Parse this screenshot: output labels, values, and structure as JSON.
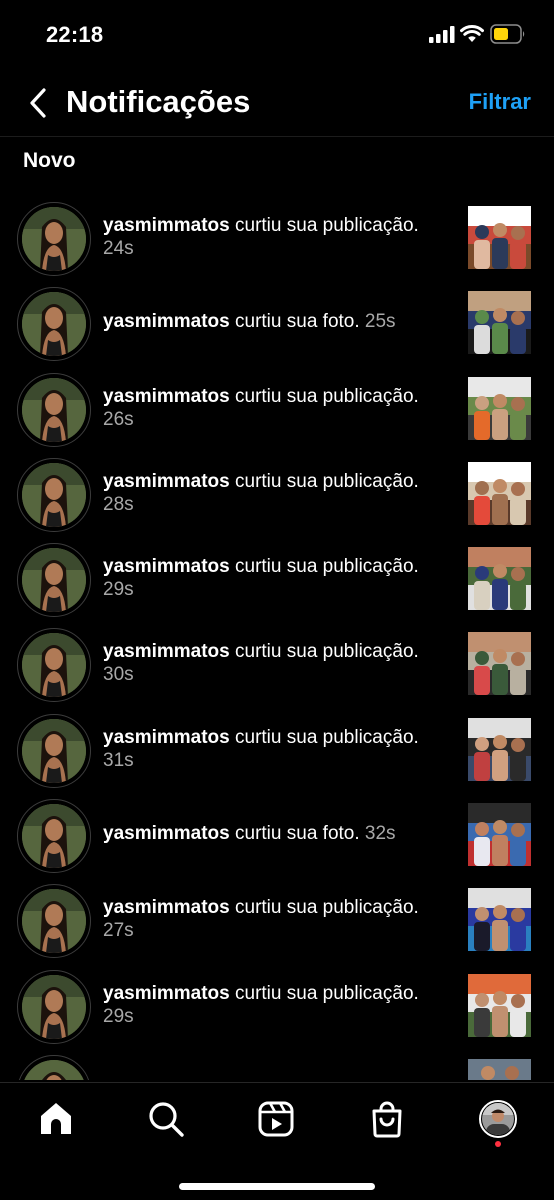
{
  "status_bar": {
    "time": "22:18",
    "battery_color": "#ffd60a"
  },
  "header": {
    "title": "Notificações",
    "filter_label": "Filtrar",
    "accent_color": "#1ea1f7"
  },
  "section": {
    "label": "Novo"
  },
  "notifications": [
    {
      "username": "yasmimmatos",
      "action": " curtiu sua publicação.",
      "time": "24s"
    },
    {
      "username": "yasmimmatos",
      "action": " curtiu sua foto.",
      "time": "25s"
    },
    {
      "username": "yasmimmatos",
      "action": " curtiu sua publicação.",
      "time": "26s"
    },
    {
      "username": "yasmimmatos",
      "action": " curtiu sua publicação.",
      "time": "28s"
    },
    {
      "username": "yasmimmatos",
      "action": " curtiu sua publicação.",
      "time": "29s"
    },
    {
      "username": "yasmimmatos",
      "action": " curtiu sua publicação.",
      "time": "30s"
    },
    {
      "username": "yasmimmatos",
      "action": " curtiu sua publicação.",
      "time": "31s"
    },
    {
      "username": "yasmimmatos",
      "action": " curtiu sua foto.",
      "time": "32s"
    },
    {
      "username": "yasmimmatos",
      "action": " curtiu sua publicação.",
      "time": "27s"
    },
    {
      "username": "yasmimmatos",
      "action": " curtiu sua publicação.",
      "time": "29s"
    }
  ],
  "bottom_nav": {
    "items": [
      "home-icon",
      "search-icon",
      "reels-icon",
      "shop-icon",
      "profile-avatar"
    ]
  }
}
